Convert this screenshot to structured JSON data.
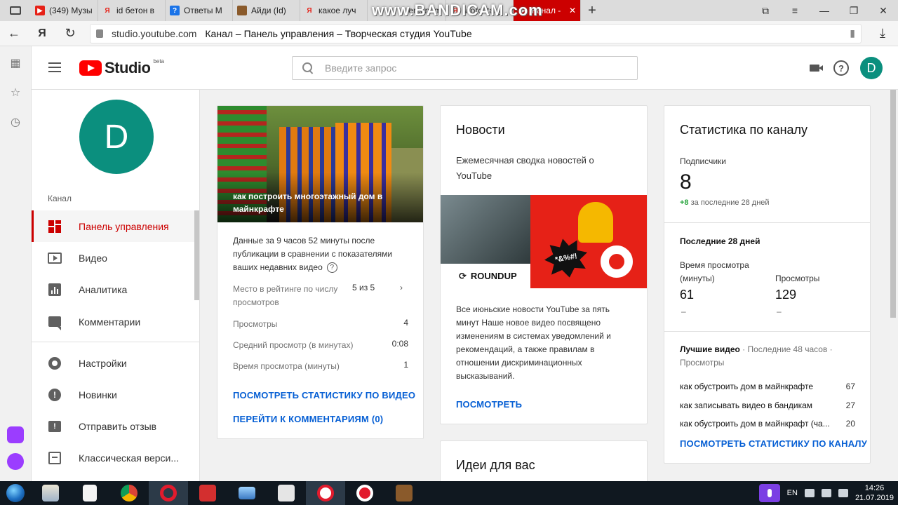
{
  "browser": {
    "tabs": [
      {
        "title": "(349) Музы",
        "fav_color": "#e62117",
        "fav_glyph": "▶"
      },
      {
        "title": "id бетон в",
        "fav_color": "#ffffff",
        "fav_glyph": "Я"
      },
      {
        "title": "Ответы M",
        "fav_color": "#1a73e8",
        "fav_glyph": "?"
      },
      {
        "title": "Айди (Id)",
        "fav_color": "#8a5a2b",
        "fav_glyph": "■"
      },
      {
        "title": "какое луч",
        "fav_color": "#ffffff",
        "fav_glyph": "Я"
      },
      {
        "title": "ercury m",
        "fav_color": "#888888",
        "fav_glyph": "●"
      },
      {
        "title": "wordstat.y",
        "fav_color": "#ffffff",
        "fav_glyph": "Я"
      },
      {
        "title": "Канал -",
        "fav_color": "#ffffff",
        "fav_glyph": "▶",
        "active": true
      }
    ],
    "watermark": "www.BANDICAM.com",
    "url_host": "studio.youtube.com",
    "page_title": "Канал – Панель управления – Творческая студия YouTube"
  },
  "header": {
    "logo_text": "Studio",
    "logo_badge": "beta",
    "search_placeholder": "Введите запрос",
    "avatar_letter": "D"
  },
  "nav": {
    "avatar_letter": "D",
    "section_label": "Канал",
    "items": [
      {
        "label": "Панель управления",
        "icon": "dashboard-icon",
        "active": true
      },
      {
        "label": "Видео",
        "icon": "video-icon"
      },
      {
        "label": "Аналитика",
        "icon": "analytics-icon"
      },
      {
        "label": "Комментарии",
        "icon": "comments-icon"
      },
      {
        "label": "Настройки",
        "icon": "settings-icon"
      },
      {
        "label": "Новинки",
        "icon": "whats-new-icon"
      },
      {
        "label": "Отправить отзыв",
        "icon": "feedback-icon"
      },
      {
        "label": "Классическая верси...",
        "icon": "classic-icon"
      }
    ]
  },
  "video_card": {
    "video_title": "как построить многоэтажный дом в майнкрафте",
    "summary": "Данные за 9 часов 52 минуты после публикации в сравнении с показателями ваших недавних видео",
    "rank_label": "Место в рейтинге по числу просмотров",
    "rank_value": "5 из 5",
    "rows": [
      {
        "label": "Просмотры",
        "value": "4"
      },
      {
        "label": "Средний просмотр (в минутах)",
        "value": "0:08"
      },
      {
        "label": "Время просмотра (минуты)",
        "value": "1"
      }
    ],
    "link_stats": "ПОСМОТРЕТЬ СТАТИСТИКУ ПО ВИДЕО",
    "link_comments": "ПЕРЕЙТИ К КОММЕНТАРИЯМ (0)"
  },
  "news_card": {
    "title": "Новости",
    "subtitle": "Ежемесячная сводка новостей о YouTube",
    "image_badge": "ROUNDUP",
    "image_burst": "*&%#!",
    "text": "Все июньские новости YouTube за пять минут Наше новое видео посвящено изменениям в системах уведомлений и рекомендаций, а также правилам в отношении дискриминационных высказываний.",
    "link": "ПОСМОТРЕТЬ"
  },
  "ideas_card": {
    "title": "Идеи для вас"
  },
  "stats_card": {
    "title": "Статистика по каналу",
    "subscribers_label": "Подписчики",
    "subscribers_value": "8",
    "subscribers_delta": "+8",
    "subscribers_delta_period": "за последние 28 дней",
    "period_title": "Последние 28 дней",
    "watch_time_label": "Время просмотра (минуты)",
    "watch_time_value": "61",
    "watch_time_trend": "–",
    "views_label": "Просмотры",
    "views_value": "129",
    "views_trend": "–",
    "best_title": "Лучшие видео",
    "best_meta": " · Последние 48 часов · Просмотры",
    "best_videos": [
      {
        "title": "как обустроить дом в майнкрафте",
        "views": "67"
      },
      {
        "title": "как записывать видео в бандикам",
        "views": "27"
      },
      {
        "title": "как обустроить дом в майнкрафт (ча...",
        "views": "20"
      }
    ],
    "link": "ПОСМОТРЕТЬ СТАТИСТИКУ ПО КАНАЛУ"
  },
  "taskbar": {
    "lang": "EN",
    "time": "14:26",
    "date": "21.07.2019"
  },
  "colors": {
    "accent_red": "#cc0000",
    "link_blue": "#065fd4",
    "avatar_teal": "#0b8f7e",
    "positive_green": "#2ba640"
  }
}
